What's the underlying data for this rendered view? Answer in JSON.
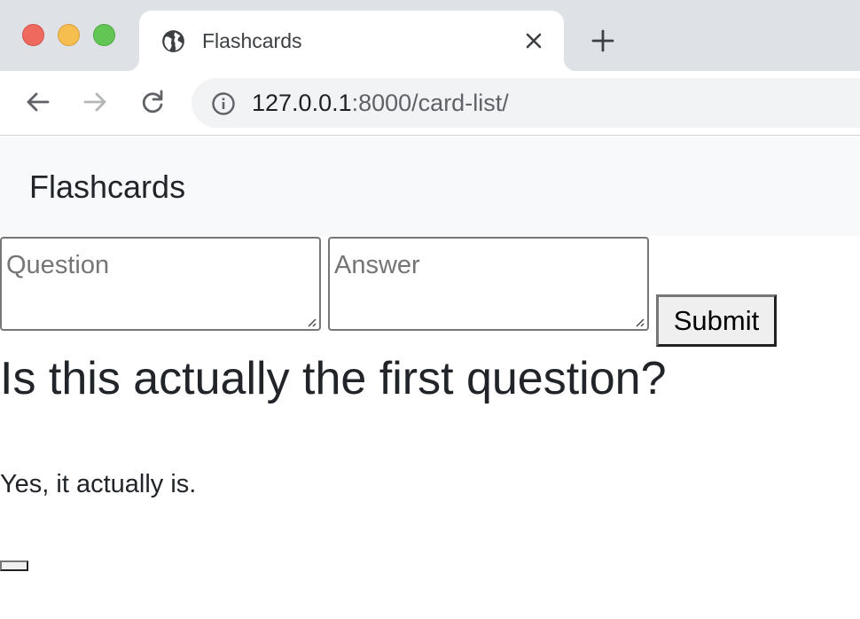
{
  "browser": {
    "tab": {
      "title": "Flashcards",
      "icon": "globe-icon",
      "close_icon": "close-icon"
    },
    "new_tab_icon": "plus-icon",
    "toolbar": {
      "back_icon": "arrow-left-icon",
      "forward_icon": "arrow-right-icon",
      "reload_icon": "reload-icon",
      "info_icon": "info-icon"
    },
    "url": {
      "host": "127.0.0.1",
      "rest": ":8000/card-list/"
    },
    "colors": {
      "close": "#ee6a5f",
      "minimize": "#f5be4f",
      "maximize": "#62c655",
      "chrome_bg": "#dee1e6"
    }
  },
  "page": {
    "brand": "Flashcards",
    "form": {
      "question_placeholder": "Question",
      "answer_placeholder": "Answer",
      "submit_label": "Submit"
    },
    "card": {
      "question": "Is this actually the first question?",
      "answer": "Yes, it actually is."
    }
  }
}
